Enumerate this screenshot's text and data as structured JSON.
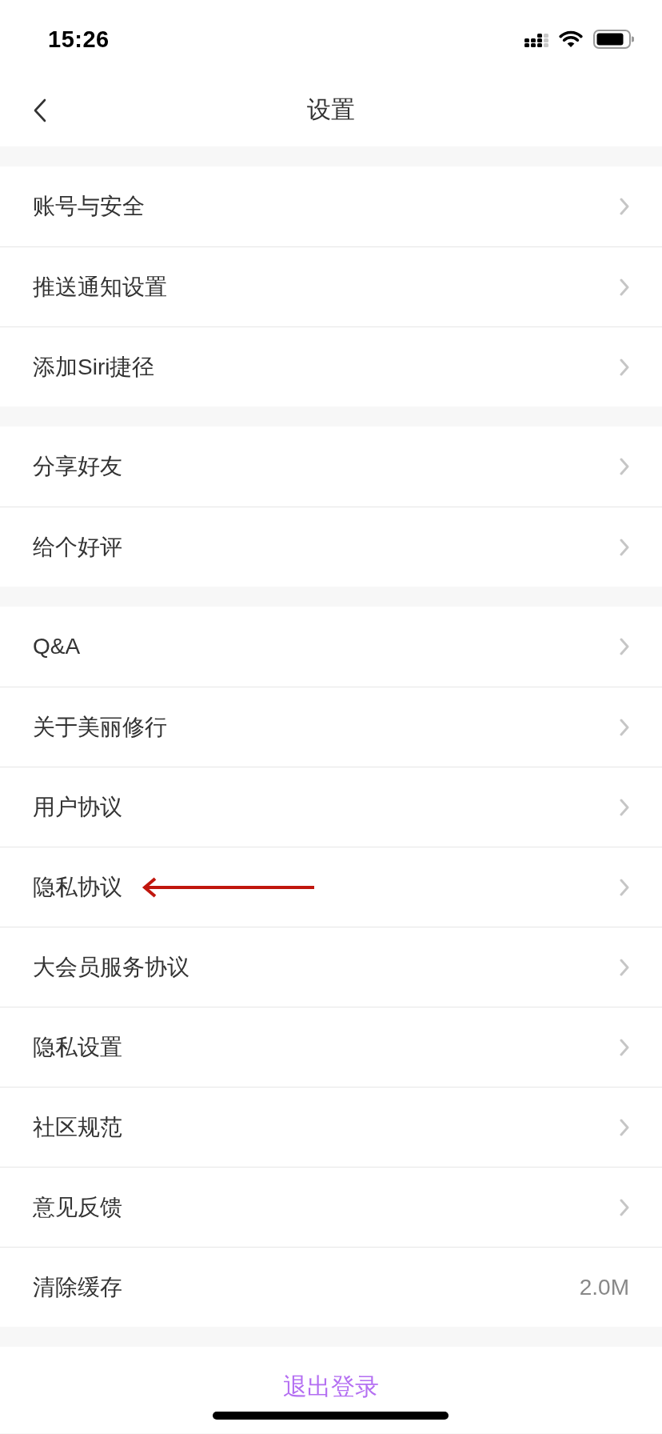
{
  "status_bar": {
    "time": "15:26"
  },
  "nav": {
    "title": "设置"
  },
  "groups": [
    {
      "rows": [
        {
          "label": "账号与安全",
          "kind": "link",
          "marked": false
        },
        {
          "label": "推送通知设置",
          "kind": "link",
          "marked": false
        },
        {
          "label": "添加Siri捷径",
          "kind": "link",
          "marked": false
        }
      ]
    },
    {
      "rows": [
        {
          "label": "分享好友",
          "kind": "link",
          "marked": false
        },
        {
          "label": "给个好评",
          "kind": "link",
          "marked": false
        }
      ]
    },
    {
      "rows": [
        {
          "label": "Q&A",
          "kind": "link",
          "marked": false
        },
        {
          "label": "关于美丽修行",
          "kind": "link",
          "marked": false
        },
        {
          "label": "用户协议",
          "kind": "link",
          "marked": false
        },
        {
          "label": "隐私协议",
          "kind": "link",
          "marked": true
        },
        {
          "label": "大会员服务协议",
          "kind": "link",
          "marked": false
        },
        {
          "label": "隐私设置",
          "kind": "link",
          "marked": false
        },
        {
          "label": "社区规范",
          "kind": "link",
          "marked": false
        },
        {
          "label": "意见反馈",
          "kind": "link",
          "marked": false
        },
        {
          "label": "清除缓存",
          "kind": "value",
          "value": "2.0M",
          "marked": false
        }
      ]
    }
  ],
  "logout_button": {
    "label": "退出登录"
  }
}
